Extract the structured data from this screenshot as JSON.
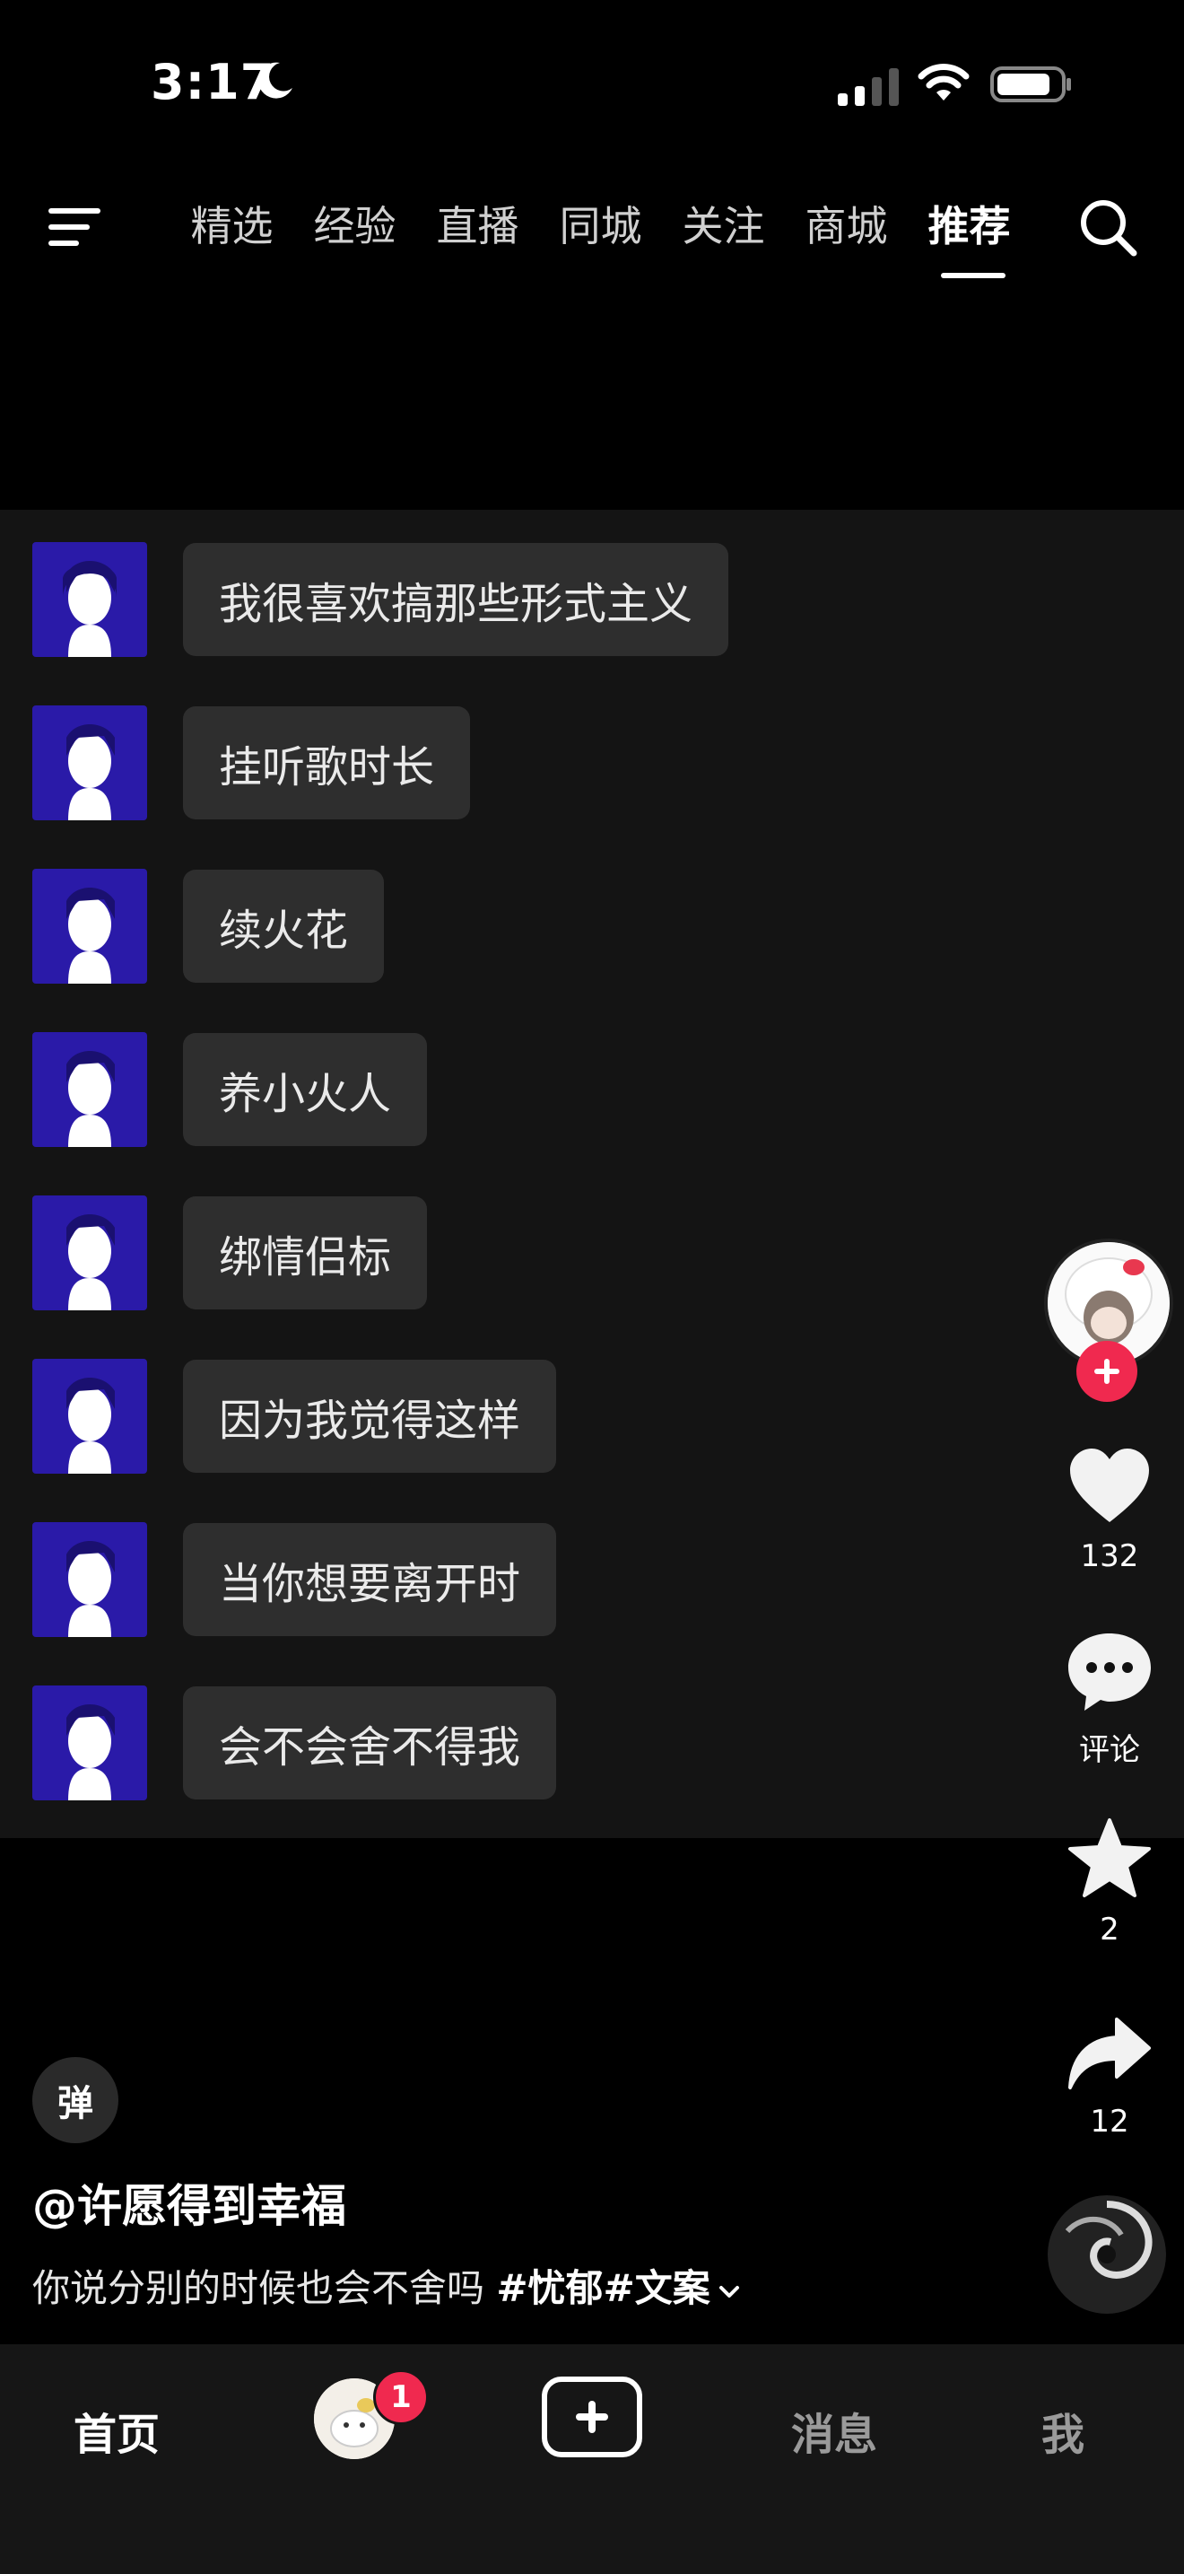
{
  "status_bar": {
    "time": "3:17"
  },
  "top_nav": {
    "tabs": [
      {
        "label": "精选"
      },
      {
        "label": "经验"
      },
      {
        "label": "直播"
      },
      {
        "label": "同城"
      },
      {
        "label": "关注"
      },
      {
        "label": "商城"
      },
      {
        "label": "推荐"
      }
    ],
    "active_tab": "推荐"
  },
  "chat": {
    "messages": [
      {
        "text": "我很喜欢搞那些形式主义"
      },
      {
        "text": "挂听歌时长"
      },
      {
        "text": "续火花"
      },
      {
        "text": "养小火人"
      },
      {
        "text": "绑情侣标"
      },
      {
        "text": "因为我觉得这样"
      },
      {
        "text": "当你想要离开时"
      },
      {
        "text": "会不会舍不得我"
      }
    ]
  },
  "right_rail": {
    "likes": "132",
    "comment_label": "评论",
    "favorites": "2",
    "shares": "12"
  },
  "video_info": {
    "danmu_button": "弹",
    "author": "@许愿得到幸福",
    "description": "你说分别的时候也会不舍吗 ",
    "tags": "#忧郁#文案"
  },
  "bottom_bar": {
    "home": "首页",
    "friend_badge": "1",
    "messages": "消息",
    "me": "我"
  },
  "colors": {
    "accent": "#f0294f",
    "chat_bg": "#141414",
    "bubble_bg": "#2e2e2e",
    "avatar_bg": "#2a1aa8"
  }
}
